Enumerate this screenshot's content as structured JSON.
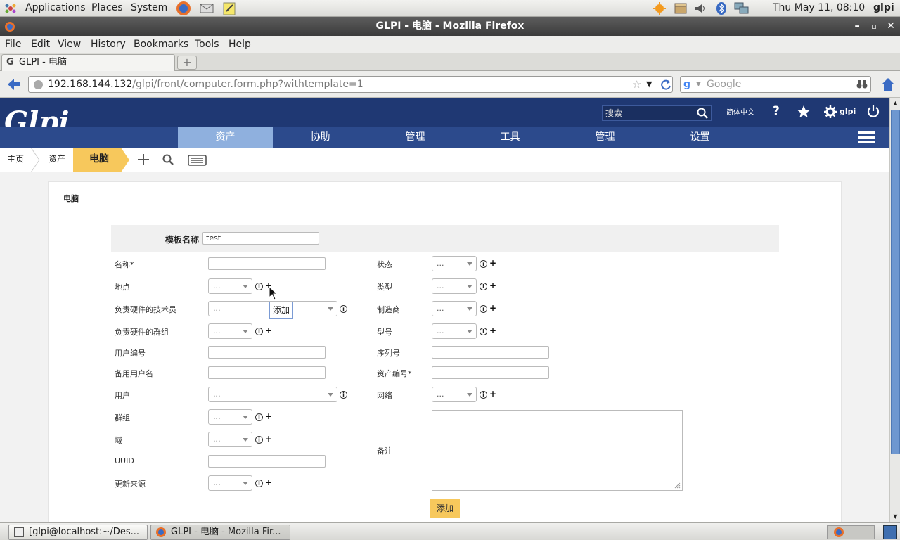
{
  "desktop": {
    "menu_applications": "Applications",
    "menu_places": "Places",
    "menu_system": "System",
    "clock": "Thu May 11, 08:10",
    "user": "glpi"
  },
  "window": {
    "title": "GLPI - 电脑 - Mozilla Firefox"
  },
  "menubar": [
    "File",
    "Edit",
    "View",
    "History",
    "Bookmarks",
    "Tools",
    "Help"
  ],
  "tab": {
    "label": "GLPI - 电脑"
  },
  "urlbar": {
    "host": "192.168.144.132",
    "path": "/glpi/front/computer.form.php?withtemplate=1",
    "search_placeholder": "Google"
  },
  "glpi": {
    "logo": "Glpi",
    "search_placeholder": "搜索",
    "language": "简体中文",
    "username": "glpi",
    "nav": [
      "资产",
      "协助",
      "管理",
      "工具",
      "管理",
      "设置"
    ],
    "breadcrumb": [
      "主页",
      "资产",
      "电脑"
    ]
  },
  "form": {
    "heading": "电脑",
    "template_label": "模板名称",
    "template_value": "test",
    "empty_option": "...",
    "left_labels": {
      "name": "名称*",
      "location": "地点",
      "tech": "负责硬件的技术员",
      "tech_group": "负责硬件的群组",
      "user_number": "用户编号",
      "alt_user": "备用用户名",
      "user": "用户",
      "group": "群组",
      "domain": "域",
      "uuid": "UUID",
      "update_source": "更新来源"
    },
    "right_labels": {
      "status": "状态",
      "type": "类型",
      "manufacturer": "制造商",
      "model": "型号",
      "serial": "序列号",
      "inventory": "资产编号*",
      "network": "网络",
      "comment": "备注"
    },
    "tooltip": "添加",
    "submit": "添加"
  },
  "taskbar": {
    "item1": "[glpi@localhost:~/Des...",
    "item2": "GLPI - 电脑 - Mozilla Fir..."
  },
  "colors": {
    "header": "#1f3873",
    "nav": "#2c4a8c",
    "nav_active": "#8fb0de",
    "crumb_active": "#f7c85c",
    "submit": "#f7c85c"
  }
}
